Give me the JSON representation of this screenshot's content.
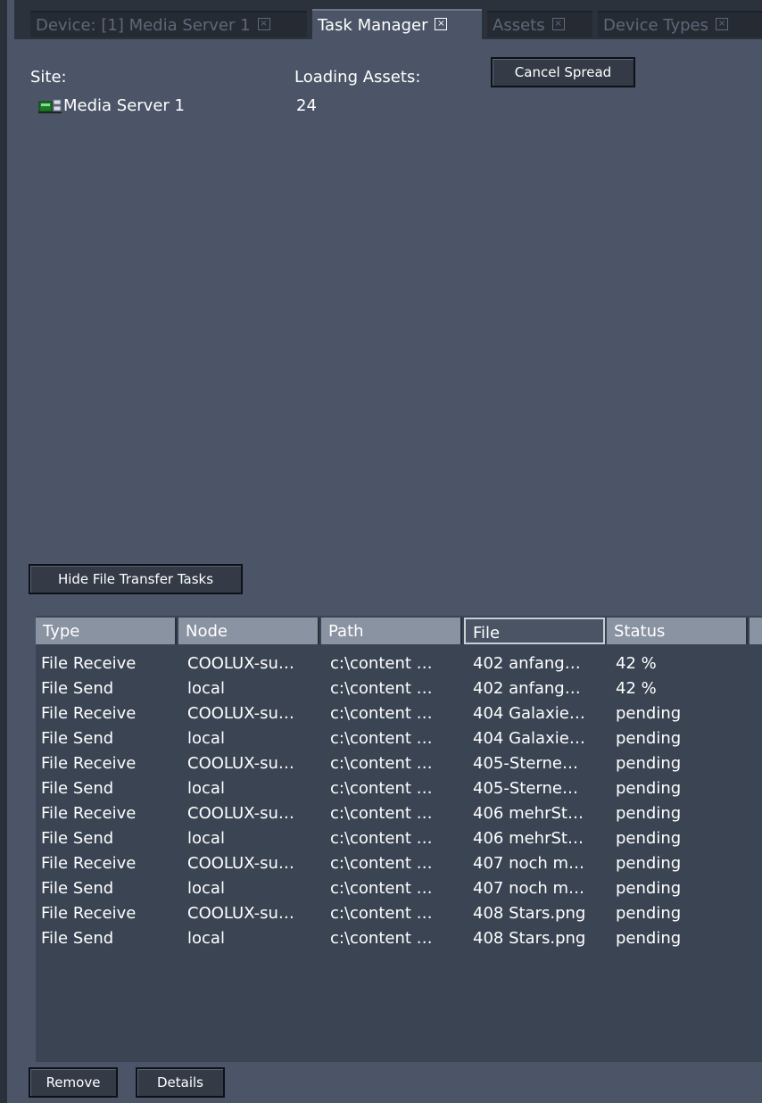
{
  "tabs": [
    {
      "label": "Device: [1] Media Server 1",
      "active": false
    },
    {
      "label": "Task Manager",
      "active": true
    },
    {
      "label": "Assets",
      "active": false
    },
    {
      "label": "Device Types",
      "active": false
    }
  ],
  "site": {
    "label": "Site:",
    "name": "Media Server 1"
  },
  "loading": {
    "label": "Loading Assets:",
    "value": "24"
  },
  "buttons": {
    "cancel_spread": "Cancel Spread",
    "hide_tasks": "Hide File Transfer Tasks",
    "remove": "Remove",
    "details": "Details"
  },
  "table": {
    "columns": [
      "Type",
      "Node",
      "Path",
      "File",
      "Status"
    ],
    "rows": [
      {
        "type": "File Receive",
        "node": "COOLUX-su…",
        "path": "c:\\content …",
        "file": "402 anfang…",
        "status": "42 %"
      },
      {
        "type": "File Send",
        "node": "local",
        "path": "c:\\content …",
        "file": "402 anfang…",
        "status": "42 %"
      },
      {
        "type": "File Receive",
        "node": "COOLUX-su…",
        "path": "c:\\content …",
        "file": "404 Galaxie…",
        "status": "pending"
      },
      {
        "type": "File Send",
        "node": "local",
        "path": "c:\\content …",
        "file": "404 Galaxie…",
        "status": "pending"
      },
      {
        "type": "File Receive",
        "node": "COOLUX-su…",
        "path": "c:\\content …",
        "file": "405-Sterne…",
        "status": "pending"
      },
      {
        "type": "File Send",
        "node": "local",
        "path": "c:\\content …",
        "file": "405-Sterne…",
        "status": "pending"
      },
      {
        "type": "File Receive",
        "node": "COOLUX-su…",
        "path": "c:\\content …",
        "file": "406 mehrSt…",
        "status": "pending"
      },
      {
        "type": "File Send",
        "node": "local",
        "path": "c:\\content …",
        "file": "406 mehrSt…",
        "status": "pending"
      },
      {
        "type": "File Receive",
        "node": "COOLUX-su…",
        "path": "c:\\content …",
        "file": "407 noch m…",
        "status": "pending"
      },
      {
        "type": "File Send",
        "node": "local",
        "path": "c:\\content …",
        "file": "407 noch m…",
        "status": "pending"
      },
      {
        "type": "File Receive",
        "node": "COOLUX-su…",
        "path": "c:\\content …",
        "file": "408 Stars.png",
        "status": "pending"
      },
      {
        "type": "File Send",
        "node": "local",
        "path": "c:\\content …",
        "file": "408 Stars.png",
        "status": "pending"
      }
    ]
  },
  "icons": {
    "site": "server-icon",
    "tab_close": "close-box-icon"
  },
  "colors": {
    "panel_bg": "#4b5567",
    "table_bg": "#3a4453",
    "header_bg": "#8a93a1",
    "text": "#ffffff"
  }
}
